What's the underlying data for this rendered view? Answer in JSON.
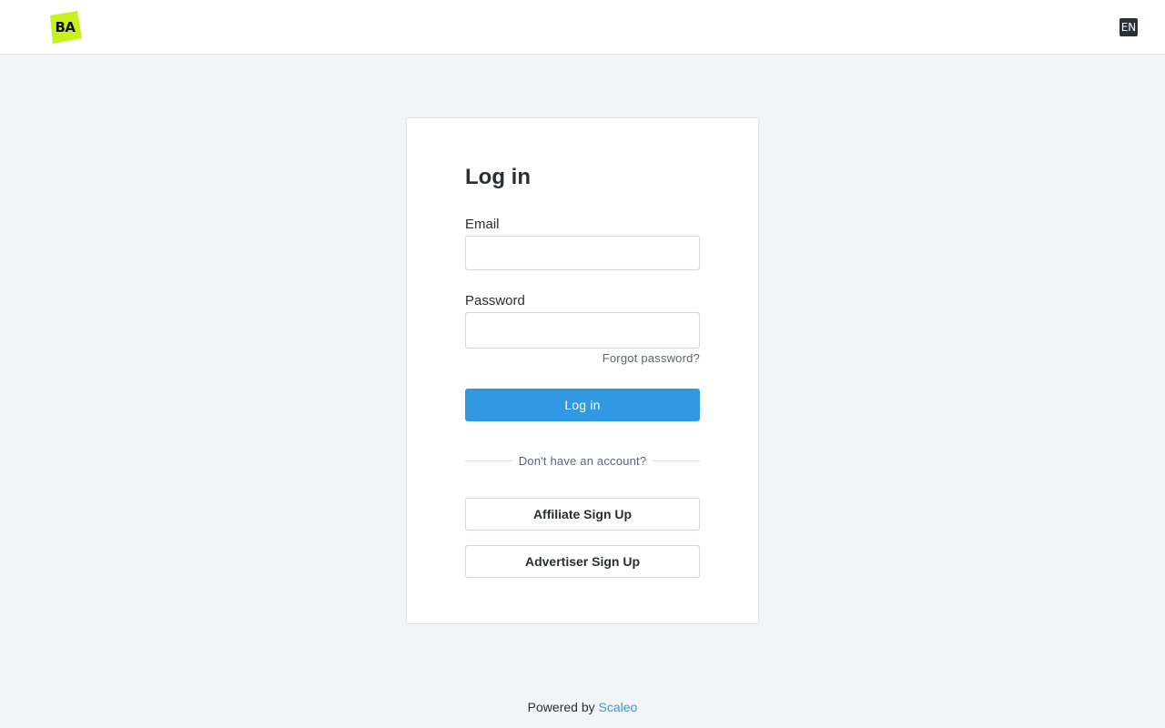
{
  "header": {
    "logo_text": "BA",
    "logo_color": "#c8f21f",
    "language": "EN"
  },
  "login": {
    "title": "Log in",
    "email_label": "Email",
    "email_value": "",
    "password_label": "Password",
    "password_value": "",
    "forgot_password": "Forgot password?",
    "submit_label": "Log in",
    "divider_text": "Don't have an account?",
    "affiliate_signup": "Affiliate Sign Up",
    "advertiser_signup": "Advertiser Sign Up"
  },
  "footer": {
    "powered_by": "Powered by",
    "brand": "Scaleo"
  },
  "colors": {
    "accent": "#3199e2",
    "background": "#f3f4f8"
  }
}
